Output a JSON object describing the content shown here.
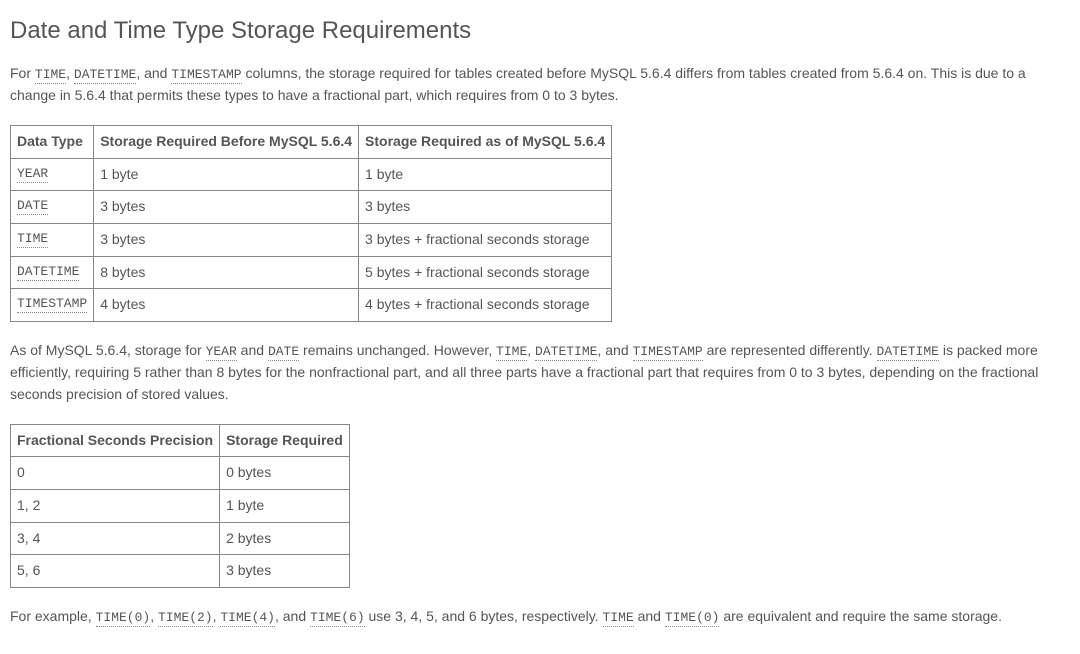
{
  "heading": "Date and Time Type Storage Requirements",
  "p1": {
    "pre": "For ",
    "c1": "TIME",
    "s1": ", ",
    "c2": "DATETIME",
    "s2": ", and ",
    "c3": "TIMESTAMP",
    "post": " columns, the storage required for tables created before MySQL 5.6.4 differs from tables created from 5.6.4 on. This is due to a change in 5.6.4 that permits these types to have a fractional part, which requires from 0 to 3 bytes."
  },
  "table1": {
    "headers": [
      "Data Type",
      "Storage Required Before MySQL 5.6.4",
      "Storage Required as of MySQL 5.6.4"
    ],
    "rows": [
      {
        "type": "YEAR",
        "before": "1 byte",
        "after": "1 byte"
      },
      {
        "type": "DATE",
        "before": "3 bytes",
        "after": "3 bytes"
      },
      {
        "type": "TIME",
        "before": "3 bytes",
        "after": "3 bytes + fractional seconds storage"
      },
      {
        "type": "DATETIME",
        "before": "8 bytes",
        "after": "5 bytes + fractional seconds storage"
      },
      {
        "type": "TIMESTAMP",
        "before": "4 bytes",
        "after": "4 bytes + fractional seconds storage"
      }
    ]
  },
  "p2": {
    "pre": "As of MySQL 5.6.4, storage for ",
    "c1": "YEAR",
    "s1": " and ",
    "c2": "DATE",
    "s2": " remains unchanged. However, ",
    "c3": "TIME",
    "s3": ", ",
    "c4": "DATETIME",
    "s4": ", and ",
    "c5": "TIMESTAMP",
    "s5": " are represented differently. ",
    "c6": "DATETIME",
    "post": " is packed more efficiently, requiring 5 rather than 8 bytes for the nonfractional part, and all three parts have a fractional part that requires from 0 to 3 bytes, depending on the fractional seconds precision of stored values."
  },
  "table2": {
    "headers": [
      "Fractional Seconds Precision",
      "Storage Required"
    ],
    "rows": [
      {
        "prec": "0",
        "storage": "0 bytes"
      },
      {
        "prec": "1, 2",
        "storage": "1 byte"
      },
      {
        "prec": "3, 4",
        "storage": "2 bytes"
      },
      {
        "prec": "5, 6",
        "storage": "3 bytes"
      }
    ]
  },
  "p3": {
    "pre": "For example, ",
    "c1": "TIME(0)",
    "s1": ", ",
    "c2": "TIME(2)",
    "s2": ", ",
    "c3": "TIME(4)",
    "s3": ", and ",
    "c4": "TIME(6)",
    "s4": " use 3, 4, 5, and 6 bytes, respectively. ",
    "c5": "TIME",
    "s5": " and ",
    "c6": "TIME(0)",
    "post": " are equivalent and require the same storage."
  }
}
